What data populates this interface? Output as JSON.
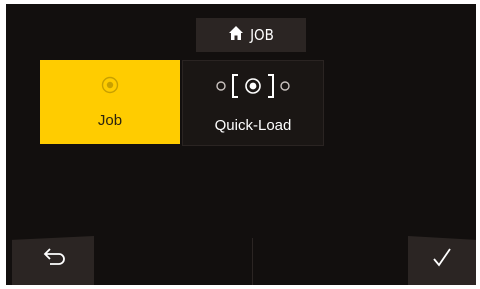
{
  "header": {
    "title": "JOB",
    "icon": "home-icon"
  },
  "cards": [
    {
      "label": "Job",
      "icon": "target-icon",
      "selected": true
    },
    {
      "label": "Quick-Load",
      "icon": "quick-load-icon",
      "selected": false
    }
  ],
  "footer": {
    "back_icon": "undo-arrow-icon",
    "confirm_icon": "checkmark-icon"
  },
  "colors": {
    "accent": "#ffcc00",
    "background": "#120f0e",
    "panel": "#2b2523"
  }
}
